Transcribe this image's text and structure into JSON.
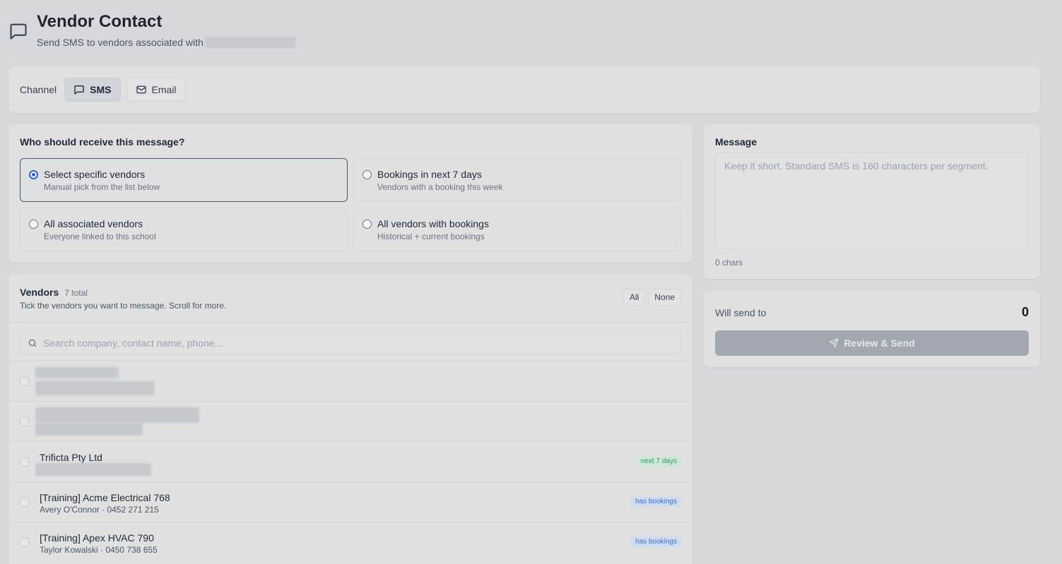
{
  "header": {
    "title": "Vendor Contact",
    "subtitle": "Send SMS to vendors associated with"
  },
  "channel": {
    "label": "Channel",
    "options": [
      {
        "label": "SMS",
        "icon": "message-square-icon",
        "active": true
      },
      {
        "label": "Email",
        "icon": "mail-icon",
        "active": false
      }
    ]
  },
  "recipients": {
    "title": "Who should receive this message?",
    "options": [
      {
        "title": "Select specific vendors",
        "desc": "Manual pick from the list below",
        "selected": true
      },
      {
        "title": "Bookings in next 7 days",
        "desc": "Vendors with a booking this week",
        "selected": false
      },
      {
        "title": "All associated vendors",
        "desc": "Everyone linked to this school",
        "selected": false
      },
      {
        "title": "All vendors with bookings",
        "desc": "Historical + current bookings",
        "selected": false
      }
    ]
  },
  "vendors": {
    "title": "Vendors",
    "count": "7 total",
    "hint": "Tick the vendors you want to message. Scroll for more.",
    "select_all": "All",
    "select_none": "None",
    "search_placeholder": "Search company, contact name, phone...",
    "rows": [
      {
        "name": "",
        "sub": "",
        "badge": ""
      },
      {
        "name": "",
        "sub": "",
        "badge": ""
      },
      {
        "name": "Trificta Pty Ltd",
        "sub": "",
        "badge": "next 7 days"
      },
      {
        "name": "[Training] Acme Electrical 768",
        "sub": "Avery O'Connor · 0452 271 215",
        "badge": "has bookings"
      },
      {
        "name": "[Training] Apex HVAC 790",
        "sub": "Taylor Kowalski · 0450 738 655",
        "badge": "has bookings"
      }
    ]
  },
  "message": {
    "title": "Message",
    "placeholder": "Keep it short. Standard SMS is 160 characters per segment.",
    "chars": "0 chars"
  },
  "send": {
    "label": "Will send to",
    "count": "0",
    "button": "Review & Send"
  }
}
